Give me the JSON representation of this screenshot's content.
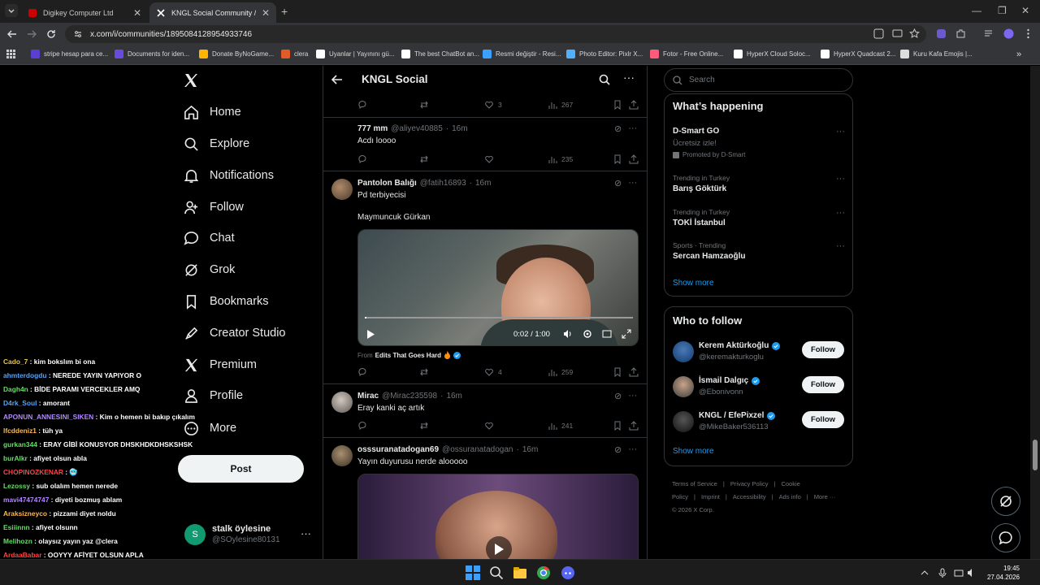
{
  "browser": {
    "tabs": [
      {
        "title": "Digikey Computer Ltd",
        "active": false,
        "favicon_color": "#cc0000"
      },
      {
        "title": "KNGL Social Community / X",
        "active": true,
        "favicon_color": "#ffffff"
      }
    ],
    "url": "x.com/i/communities/1895084128954933746",
    "bookmarks": [
      {
        "label": "stripe hesap para ce...",
        "color": "#5a3fd1"
      },
      {
        "label": "Documents for iden...",
        "color": "#6b4ae0"
      },
      {
        "label": "Donate ByNoGame...",
        "color": "#ffb400"
      },
      {
        "label": "clera",
        "color": "#e05a2a"
      },
      {
        "label": "Uyanlar | Yayınını gü...",
        "color": "#ffffff"
      },
      {
        "label": "The best ChatBot an...",
        "color": "#ffffff"
      },
      {
        "label": "Resmi değiştir - Resi...",
        "color": "#3aa1ff"
      },
      {
        "label": "Photo Editor: Pixlr X...",
        "color": "#4fb0ff"
      },
      {
        "label": "Fotor - Free Online...",
        "color": "#ff5a7a"
      },
      {
        "label": "HyperX Cloud Soloc...",
        "color": "#ffffff"
      },
      {
        "label": "HyperX Quadcast 2...",
        "color": "#ffffff"
      },
      {
        "label": "Kuru Kafa Emojis |...",
        "color": "#dddddd"
      }
    ]
  },
  "chat": [
    {
      "user": "",
      "msg": "",
      "color": "#a0a0a0"
    },
    {
      "user": "Cado_7",
      "msg": " : kim bokslım bi ona",
      "color": "#e8c54a"
    },
    {
      "user": "ahmterdogdu",
      "msg": " : NEREDE YAYIN YAPIYOR O",
      "color": "#4da6ff"
    },
    {
      "user": "Dagh4n",
      "msg": " : BİDE PARAMI VERCEKLER AMQ",
      "color": "#66dd66"
    },
    {
      "user": "D4rk_Soul",
      "msg": " : amorant",
      "color": "#4da6ff"
    },
    {
      "user": "APONUN_ANNESINI_SIKEN",
      "msg": " : Kim o hemen bi bakıp çıkalım",
      "color": "#b388ff"
    },
    {
      "user": "lfcddeniz1",
      "msg": " : tüh ya",
      "color": "#ffb74d"
    },
    {
      "user": "gurkan344",
      "msg": " : ERAY GİBİ KONUSYOR DHSKHDKDHSKSHSK",
      "color": "#66dd66"
    },
    {
      "user": "burAlkr",
      "msg": " : afiyet olsun abla",
      "color": "#66dd66"
    },
    {
      "user": "CHOPINOZKENAR",
      "msg": " : 🥶",
      "color": "#ff4444"
    },
    {
      "user": "Lezossy",
      "msg": " : sub olalım hemen nerede",
      "color": "#66dd66"
    },
    {
      "user": "mavi47474747",
      "msg": " : diyeti bozmuş ablam",
      "color": "#b388ff"
    },
    {
      "user": "Araksizneyco",
      "msg": " : pizzami diyet noldu",
      "color": "#ffb74d"
    },
    {
      "user": "Esiiinnn",
      "msg": " : afiyet olsunn",
      "color": "#66dd66"
    },
    {
      "user": "Melihozn",
      "msg": " : olaysız yayın yaz @clera",
      "color": "#66dd66"
    },
    {
      "user": "ArdaaBabar",
      "msg": " : OOYYY AFİYET OLSUN APLA",
      "color": "#ff4444"
    }
  ],
  "nav": {
    "items": [
      {
        "label": "Home",
        "icon": "home-icon"
      },
      {
        "label": "Explore",
        "icon": "search-icon"
      },
      {
        "label": "Notifications",
        "icon": "bell-icon"
      },
      {
        "label": "Follow",
        "icon": "add-user-icon"
      },
      {
        "label": "Chat",
        "icon": "chat-icon"
      },
      {
        "label": "Grok",
        "icon": "grok-icon"
      },
      {
        "label": "Bookmarks",
        "icon": "bookmark-icon"
      },
      {
        "label": "Creator Studio",
        "icon": "rocket-icon"
      },
      {
        "label": "Premium",
        "icon": "x-icon"
      },
      {
        "label": "Profile",
        "icon": "profile-icon"
      },
      {
        "label": "More",
        "icon": "more-icon"
      }
    ],
    "post_label": "Post",
    "account": {
      "initial": "S",
      "name": "stalk öylesine",
      "handle": "@SOylesine80131"
    }
  },
  "feed": {
    "title": "KNGL Social",
    "tweets": [
      {
        "name": "",
        "handle": "",
        "time": "",
        "text": "",
        "replies": "",
        "retweets": "",
        "likes": "3",
        "views": "267"
      },
      {
        "name": "777 mm",
        "handle": "@aliyev40885",
        "time": "16m",
        "text": "Acdı loooo",
        "likes": "",
        "views": "235"
      },
      {
        "name": "Pantolon Balığı",
        "handle": "@fatih16893",
        "time": "16m",
        "text": "Pd terbiyecisi",
        "text2": "Maymuncuk Gürkan",
        "video_time": "0:02 / 1:00",
        "from_label": "From",
        "from_source": "Edits That Goes Hard",
        "likes": "4",
        "views": "259"
      },
      {
        "name": "Mirac",
        "handle": "@Mirac235598",
        "time": "16m",
        "text": "Eray kanki aç artık",
        "likes": "",
        "views": "241"
      },
      {
        "name": "osssuranatadogan69",
        "handle": "@ossuranatadogan",
        "time": "16m",
        "text": "Yayın duyurusu nerde alooooo"
      }
    ]
  },
  "right": {
    "search_placeholder": "Search",
    "happening_title": "What’s happening",
    "trends": [
      {
        "meta": "",
        "topic": "D-Smart GO",
        "sub": "Ücretsiz izle!",
        "promo": "Promoted by D-Smart"
      },
      {
        "meta": "Trending in Turkey",
        "topic": "Barış Göktürk"
      },
      {
        "meta": "Trending in Turkey",
        "topic": "TOKİ İstanbul"
      },
      {
        "meta": "Sports · Trending",
        "topic": "Sercan Hamzaoğlu"
      }
    ],
    "show_more": "Show more",
    "who_title": "Who to follow",
    "who": [
      {
        "name": "Kerem Aktürkoğlu",
        "handle": "@keremakturkoglu",
        "follow": "Follow"
      },
      {
        "name": "İsmail Dalgıç",
        "handle": "@Ebonivonn",
        "follow": "Follow"
      },
      {
        "name": "KNGL / EfePixzel",
        "handle": "@MikeBaker536113",
        "follow": "Follow"
      }
    ],
    "footer": [
      "Terms of Service",
      "|",
      "Privacy Policy",
      "|",
      "Cookie Policy",
      "|",
      "Imprint",
      "|",
      "Accessibility",
      "|",
      "Ads info",
      "|",
      "More ···",
      "© 2026 X Corp."
    ]
  },
  "taskbar": {
    "time": "19:45",
    "date": "27.04.2026"
  },
  "colors": {
    "accent": "#1d9bf0",
    "verified": "#1d9bf0"
  }
}
